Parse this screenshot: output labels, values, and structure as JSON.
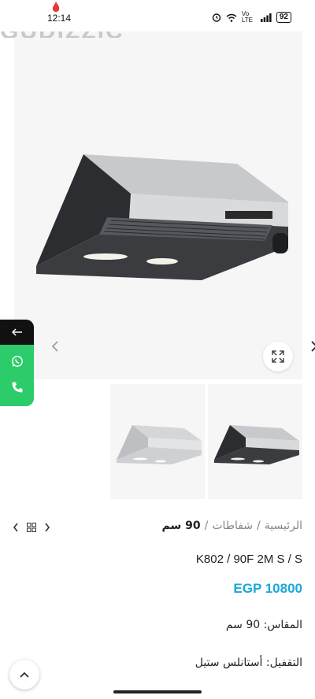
{
  "status_bar": {
    "time": "12:14",
    "network": "Vo LTE",
    "battery": "92"
  },
  "brand_fragment": "GUDIZZIC",
  "breadcrumb": {
    "home": "الرئيسية",
    "category": "شفاطات",
    "current": "90 سم",
    "separator": "/"
  },
  "product": {
    "title": "K802 / 90F 2M S / S",
    "price": "EGP 10800",
    "specs": [
      {
        "label": "المقاس:",
        "value": "90 سم"
      },
      {
        "label": "التقفيل:",
        "value": "أستانلس ستيل"
      },
      {
        "label": "",
        "value": ""
      }
    ]
  },
  "icons": {
    "slider_prev": "chevron-left-icon",
    "slider_next": "chevron-right-icon",
    "zoom": "expand-icon",
    "back": "arrow-left-icon",
    "whatsapp": "whatsapp-icon",
    "phone": "phone-icon",
    "grid": "grid-icon",
    "scroll_top": "chevron-up-icon"
  },
  "colors": {
    "price": "#1aa8d8",
    "contact_green": "#2ccc6a",
    "contact_dark": "#111111"
  }
}
